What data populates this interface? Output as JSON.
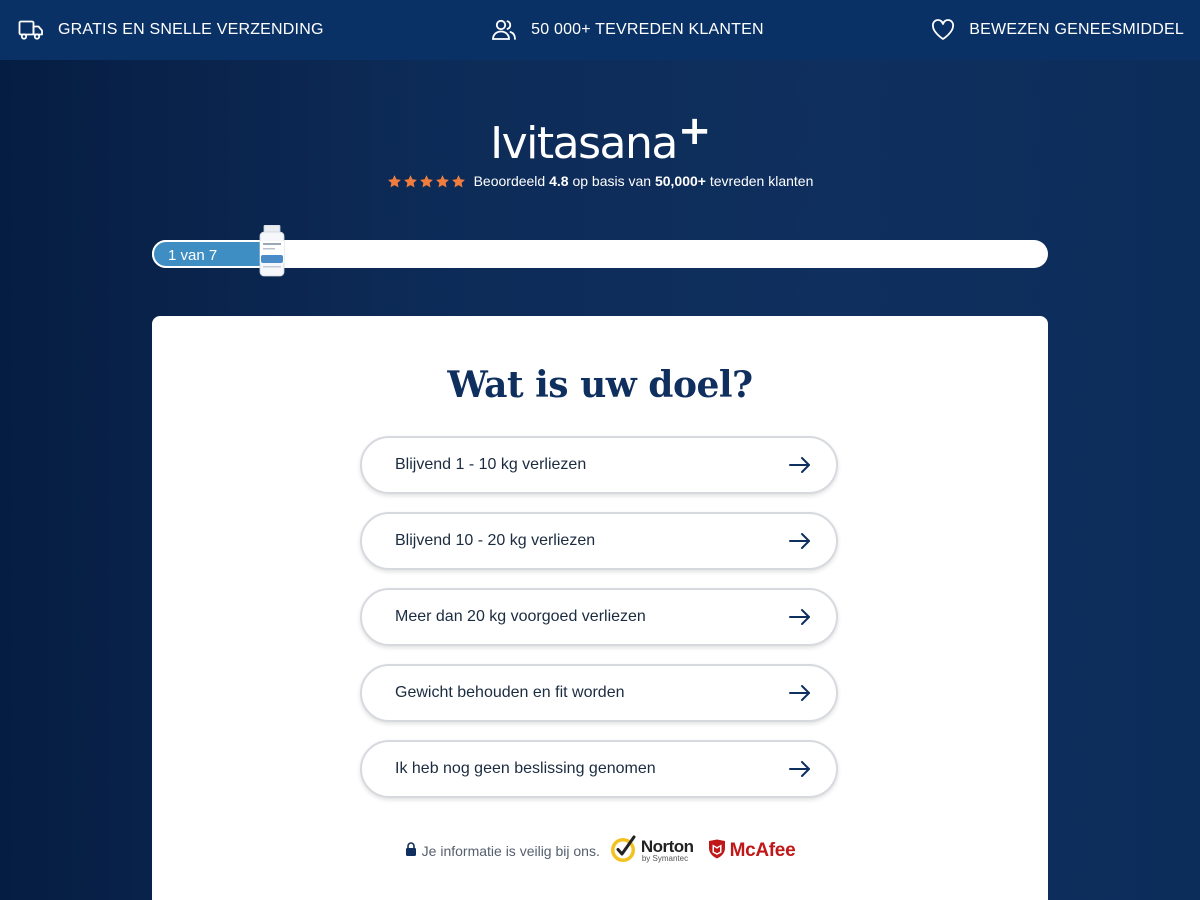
{
  "topbar": {
    "shipping": {
      "label": "GRATIS EN SNELLE VERZENDING",
      "icon": "truck-icon"
    },
    "customers": {
      "label": "50 000+ TEVREDEN KLANTEN",
      "icon": "users-icon"
    },
    "proven": {
      "label": "BEWEZEN GENEESMIDDEL",
      "icon": "heart-icon"
    }
  },
  "brand": {
    "name": "Ivitasana",
    "plus": "+"
  },
  "rating": {
    "stars": 5,
    "prefix": "Beoordeeld",
    "score": "4.8",
    "middle": "op basis van",
    "count": "50,000+",
    "suffix": "tevreden klanten",
    "star_color": "#f07c3e"
  },
  "progress": {
    "label": "1 van 7",
    "current": 1,
    "total": 7
  },
  "quiz": {
    "title": "Wat is uw doel?",
    "options": [
      {
        "label": "Blijvend 1 - 10 kg verliezen"
      },
      {
        "label": "Blijvend 10 - 20 kg verliezen"
      },
      {
        "label": "Meer dan 20 kg voorgoed verliezen"
      },
      {
        "label": "Gewicht behouden en fit worden"
      },
      {
        "label": "Ik heb nog geen beslissing genomen"
      }
    ]
  },
  "security": {
    "text": "Je informatie is veilig bij ons.",
    "norton": "Norton",
    "norton_sub": "by Symantec",
    "mcafee": "McAfee"
  },
  "colors": {
    "accent": "#3e8dc3",
    "navy": "#0f2f5e",
    "topbar": "#0a3166"
  }
}
